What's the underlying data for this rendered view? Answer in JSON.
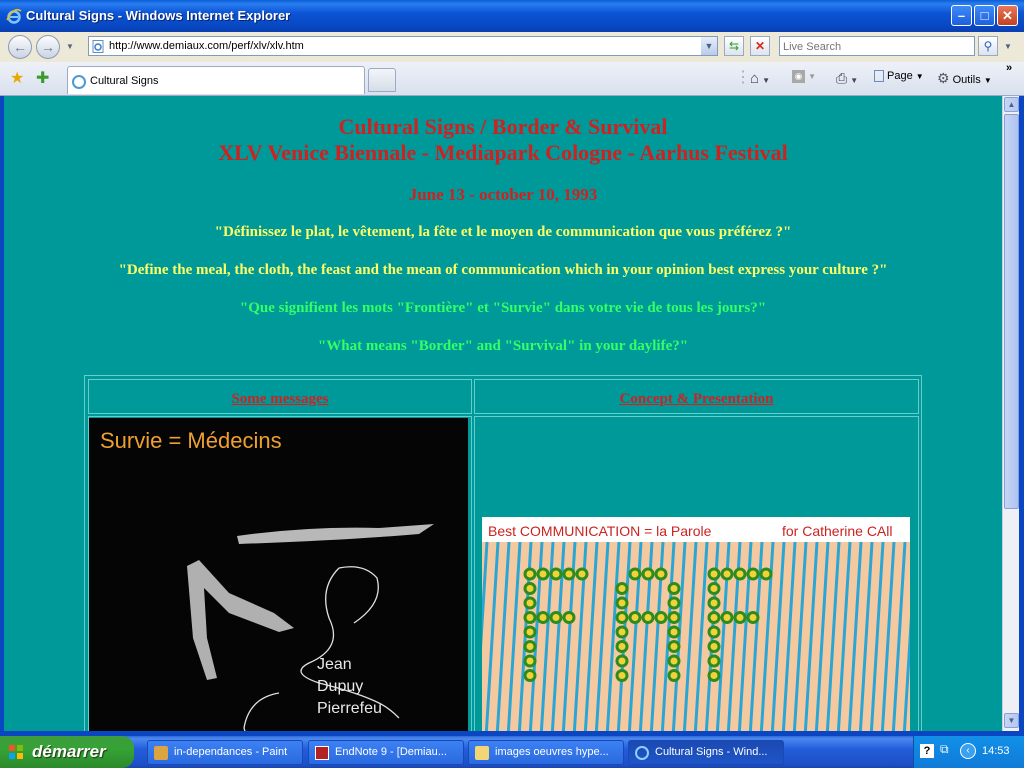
{
  "window": {
    "title": "Cultural Signs - Windows Internet Explorer",
    "min_glyph": "–",
    "max_glyph": "□",
    "close_glyph": "✕"
  },
  "browser": {
    "url": "http://www.demiaux.com/perf/xlv/xlv.htm",
    "search_placeholder": "Live Search",
    "tab_title": "Cultural Signs",
    "page_label": "Page",
    "tools_label": "Outils"
  },
  "page": {
    "title_line1": "Cultural Signs / Border & Survival",
    "title_line2": "XLV Venice Biennale - Mediapark Cologne - Aarhus Festival",
    "dates": "June 13 - october 10, 1993",
    "q1": "\"Définissez le plat, le vêtement, la fête et le moyen de communication que vous préférez ?\"",
    "q2": "\"Define the meal, the cloth, the feast and the mean of communication which in your opinion best express your culture ?\"",
    "q3": "\"Que signifient les mots \"Frontière\" et \"Survie\" dans votre vie de tous les jours?\"",
    "q4": "\"What means \"Border\" and \"Survival\" in your daylife?\"",
    "link_messages": "Some messages",
    "link_concept": "Concept & Presentation",
    "image1": {
      "caption": "Survie = Médecins",
      "name1": "Jean",
      "name2": "Dupuy",
      "name3": "Pierrefeu"
    },
    "image2": {
      "caption_left": "Best COMMUNICATION = la Parole",
      "caption_right": "for Catherine CAll"
    }
  },
  "colors": {
    "page_bg": "#009999",
    "heading_red": "#cc2222",
    "question_yellow": "#ffff66",
    "question_green": "#33ff66",
    "dot_green": "#2e8b1e"
  },
  "taskbar": {
    "start_label": "démarrer",
    "tasks": [
      {
        "label": "in-dependances - Paint",
        "icon": "paint-icon"
      },
      {
        "label": "EndNote 9 - [Demiau...",
        "icon": "endnote-icon"
      },
      {
        "label": "images oeuvres hype...",
        "icon": "folder-icon"
      },
      {
        "label": "Cultural Signs - Wind...",
        "icon": "ie-icon"
      }
    ],
    "clock": "14:53"
  }
}
